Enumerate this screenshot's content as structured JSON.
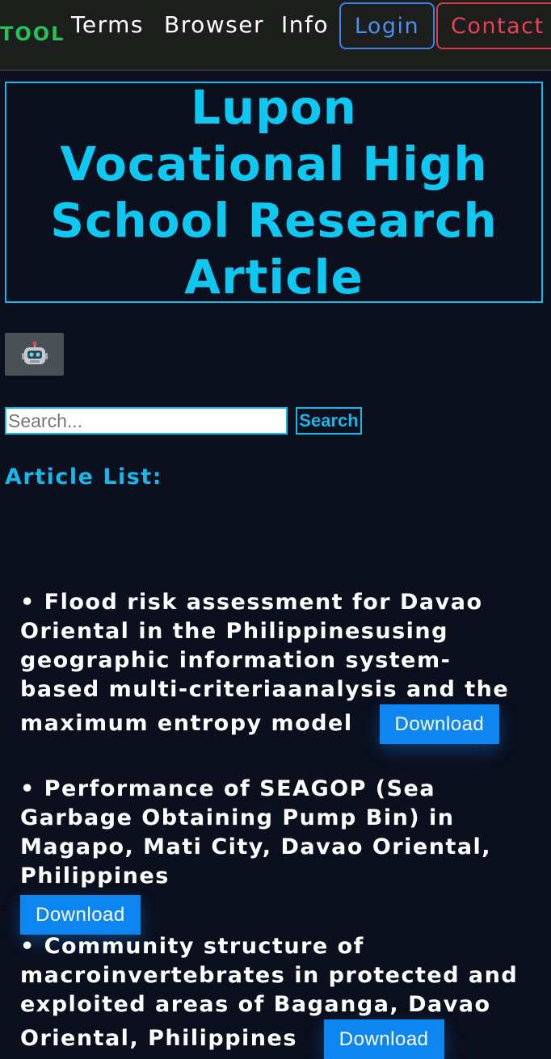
{
  "navbar": {
    "brand": "TOOL",
    "links": [
      "Terms",
      "Browser",
      "Info"
    ],
    "login_label": "Login",
    "contact_label": "Contact",
    "colors": {
      "brand": "#27c15a",
      "login": "#3d83e6",
      "contact": "#e0394e",
      "background": "#1d1f1c"
    }
  },
  "hero": {
    "title": "Lupon Vocational High School Research Article",
    "accent": "#0fc8f2"
  },
  "tool_button": {
    "icon": "robot-icon",
    "glyph": "🤖"
  },
  "search": {
    "placeholder": "Search...",
    "value": "",
    "button_label": "Search"
  },
  "list_heading": "Article List:",
  "articles": [
    {
      "bullet": "• ",
      "title": "Flood risk assessment for Davao Oriental in the Philippinesusing geographic information system-based multi-criteriaanalysis and the maximum entropy model",
      "download_label": "Download"
    },
    {
      "bullet": "• ",
      "title": "Performance of SEAGOP (Sea Garbage Obtaining Pump Bin) in Magapo, Mati City, Davao Oriental, Philippines",
      "download_label": "Download"
    },
    {
      "bullet": "• ",
      "title": "Community structure of macroinvertebrates in protected and exploited areas of Baganga, Davao Oriental, Philippines",
      "download_label": "Download"
    }
  ]
}
